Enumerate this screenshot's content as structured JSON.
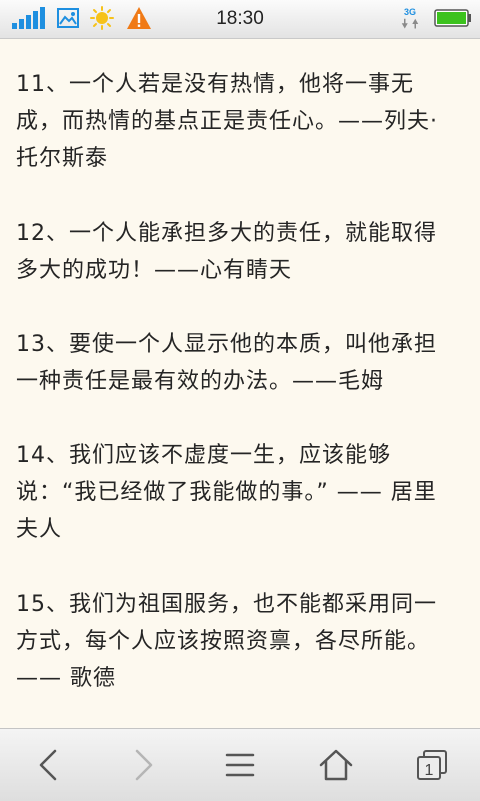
{
  "status_bar": {
    "time": "18:30",
    "network": "3G",
    "icons": [
      "signal-icon",
      "gallery-icon",
      "sun-icon",
      "warning-icon",
      "network-3g-icon",
      "battery-icon"
    ]
  },
  "quotes": [
    "11、一个人若是没有热情，他将一事无成，而热情的基点正是责任心。——列夫·托尔斯泰",
    "12、一个人能承担多大的责任，就能取得多大的成功！——心有睛天",
    "13、要使一个人显示他的本质，叫他承担一种责任是最有效的办法。——毛姆",
    "14、我们应该不虚度一生，应该能够说：“我已经做了我能做的事。” —— 居里夫人",
    "15、我们为祖国服务，也不能都采用同一方式，每个人应该按照资禀，各尽所能。—— 歌德"
  ],
  "toolbar": {
    "tab_count": "1",
    "icons": [
      "back-icon",
      "forward-icon",
      "menu-icon",
      "home-icon",
      "tabs-icon"
    ]
  },
  "colors": {
    "background": "#fdf9ef",
    "text": "#252525",
    "signal": "#1e8fe0",
    "warning": "#f07a16",
    "battery": "#3cc21e"
  }
}
